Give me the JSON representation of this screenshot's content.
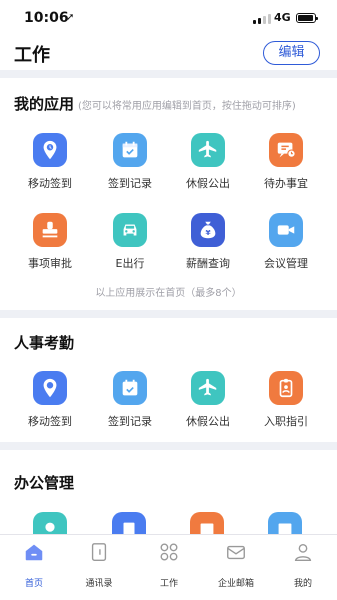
{
  "status_bar": {
    "time": "10:06",
    "network": "4G"
  },
  "header": {
    "title": "工作",
    "edit_label": "编辑"
  },
  "my_apps": {
    "title": "我的应用",
    "hint": "(您可以将常用应用编辑到首页，按住拖动可排序)",
    "items": [
      {
        "label": "移动签到",
        "icon": "location-pin-icon",
        "color": "#4a7cf0"
      },
      {
        "label": "签到记录",
        "icon": "calendar-check-icon",
        "color": "#53a6ee"
      },
      {
        "label": "休假公出",
        "icon": "airplane-icon",
        "color": "#3fc5c0"
      },
      {
        "label": "待办事宜",
        "icon": "todo-chat-icon",
        "color": "#f07a3f"
      },
      {
        "label": "事项审批",
        "icon": "stamp-icon",
        "color": "#f07a3f"
      },
      {
        "label": "E出行",
        "icon": "car-icon",
        "color": "#3fc5c0"
      },
      {
        "label": "薪酬查询",
        "icon": "money-bag-icon",
        "color": "#3f5fd6"
      },
      {
        "label": "会议管理",
        "icon": "video-camera-icon",
        "color": "#53a6ee"
      }
    ],
    "note": "以上应用展示在首页（最多8个）"
  },
  "hr_attendance": {
    "title": "人事考勤",
    "items": [
      {
        "label": "移动签到",
        "icon": "location-pin-icon",
        "color": "#4a7cf0"
      },
      {
        "label": "签到记录",
        "icon": "calendar-check-icon",
        "color": "#53a6ee"
      },
      {
        "label": "休假公出",
        "icon": "airplane-icon",
        "color": "#3fc5c0"
      },
      {
        "label": "入职指引",
        "icon": "badge-icon",
        "color": "#f07a3f"
      }
    ]
  },
  "office_management": {
    "title": "办公管理"
  },
  "tabbar": {
    "items": [
      {
        "label": "首页",
        "icon": "home-icon",
        "active": true
      },
      {
        "label": "通讯录",
        "icon": "contacts-icon",
        "active": false
      },
      {
        "label": "工作",
        "icon": "grid-icon",
        "active": false
      },
      {
        "label": "企业邮箱",
        "icon": "mail-icon",
        "active": false
      },
      {
        "label": "我的",
        "icon": "person-icon",
        "active": false
      }
    ],
    "active_color": "#2f5bd8"
  }
}
